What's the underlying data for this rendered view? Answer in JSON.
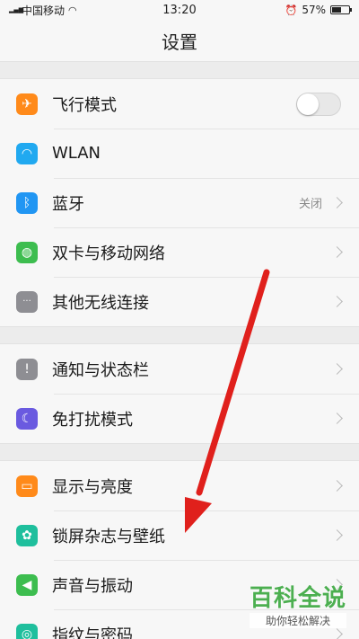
{
  "status_bar": {
    "carrier": "中国移动",
    "time": "13:20",
    "battery": "57%",
    "battery_level": 0.57
  },
  "header": {
    "title": "设置"
  },
  "groups": [
    {
      "items": [
        {
          "label": "飞行模式",
          "icon": "airplane-icon",
          "color": "#ff8a1a",
          "toggle": "off"
        },
        {
          "label": "WLAN",
          "icon": "wifi-icon",
          "color": "#21a9f0"
        },
        {
          "label": "蓝牙",
          "icon": "bluetooth-icon",
          "color": "#2196f3",
          "value": "关闭"
        },
        {
          "label": "双卡与移动网络",
          "icon": "globe-icon",
          "color": "#3dbd4f"
        },
        {
          "label": "其他无线连接",
          "icon": "more-icon",
          "color": "#8e8e93"
        }
      ]
    },
    {
      "items": [
        {
          "label": "通知与状态栏",
          "icon": "exclamation-icon",
          "color": "#8e8e93"
        },
        {
          "label": "免打扰模式",
          "icon": "moon-icon",
          "color": "#6a5ae0"
        }
      ]
    },
    {
      "items": [
        {
          "label": "显示与亮度",
          "icon": "display-icon",
          "color": "#ff8a1a"
        },
        {
          "label": "锁屏杂志与壁纸",
          "icon": "flower-icon",
          "color": "#1fbf9d"
        },
        {
          "label": "声音与振动",
          "icon": "speaker-icon",
          "color": "#3dbd4f"
        },
        {
          "label": "指纹与密码",
          "icon": "fingerprint-icon",
          "color": "#1fbf9d"
        }
      ]
    }
  ],
  "watermark": {
    "title": "百科全说",
    "subtitle": "助你轻松解决"
  },
  "colors": {
    "arrow": "#e0201c",
    "watermark_green": "#4caf50"
  }
}
